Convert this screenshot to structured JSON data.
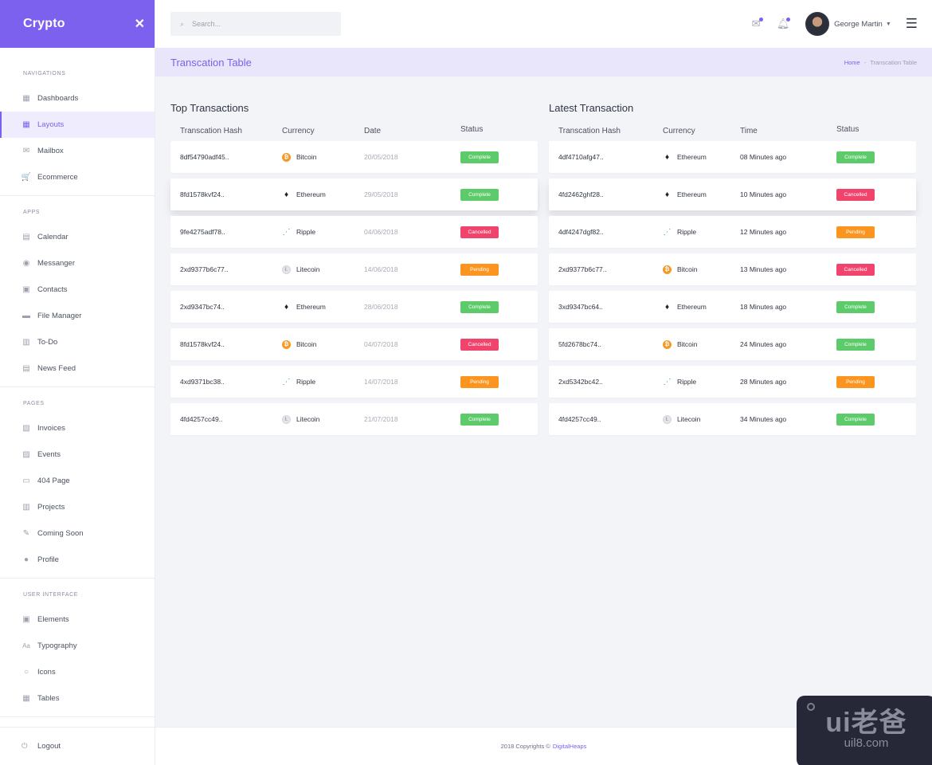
{
  "app": {
    "title": "Crypto"
  },
  "sidebar": {
    "sections": [
      {
        "heading": "Navigations",
        "items": [
          {
            "label": "Dashboards",
            "icon": "dashboard-icon",
            "glyph": "▦"
          },
          {
            "label": "Layouts",
            "icon": "layouts-icon",
            "glyph": "▦",
            "active": true
          },
          {
            "label": "Mailbox",
            "icon": "mail-icon",
            "glyph": "✉"
          },
          {
            "label": "Ecommerce",
            "icon": "cart-icon",
            "glyph": "🛒"
          }
        ]
      },
      {
        "heading": "Apps",
        "items": [
          {
            "label": "Calendar",
            "icon": "calendar-icon",
            "glyph": "▤"
          },
          {
            "label": "Messanger",
            "icon": "chat-icon",
            "glyph": "◉"
          },
          {
            "label": "Contacts",
            "icon": "contacts-icon",
            "glyph": "▣"
          },
          {
            "label": "File Manager",
            "icon": "folder-icon",
            "glyph": "▬"
          },
          {
            "label": "To-Do",
            "icon": "clipboard-icon",
            "glyph": "▥"
          },
          {
            "label": "News Feed",
            "icon": "news-icon",
            "glyph": "▤"
          }
        ]
      },
      {
        "heading": "Pages",
        "items": [
          {
            "label": "Invoices",
            "icon": "invoice-icon",
            "glyph": "▧"
          },
          {
            "label": "Events",
            "icon": "events-icon",
            "glyph": "▨"
          },
          {
            "label": "404 Page",
            "icon": "monitor-icon",
            "glyph": "▭"
          },
          {
            "label": "Projects",
            "icon": "projects-icon",
            "glyph": "▥"
          },
          {
            "label": "Coming Soon",
            "icon": "rocket-icon",
            "glyph": "✎"
          },
          {
            "label": "Profile",
            "icon": "user-icon",
            "glyph": "●"
          }
        ]
      },
      {
        "heading": "User Interface",
        "items": [
          {
            "label": "Elements",
            "icon": "elements-icon",
            "glyph": "▣"
          },
          {
            "label": "Typography",
            "icon": "typography-icon",
            "glyph": "Aa"
          },
          {
            "label": "Icons",
            "icon": "circle-icon",
            "glyph": "○"
          },
          {
            "label": "Tables",
            "icon": "table-icon",
            "glyph": "▦"
          }
        ]
      }
    ],
    "logout_label": "Logout"
  },
  "topbar": {
    "search_placeholder": "Search...",
    "user_name": "George Martin"
  },
  "pagebar": {
    "title": "Transcation Table",
    "breadcrumb": {
      "home": "Home",
      "separator": "-",
      "current": "Transcation Table"
    }
  },
  "top_transactions": {
    "title": "Top Transactions",
    "columns": [
      "Transcation Hash",
      "Currency",
      "Date",
      "Status"
    ],
    "rows": [
      {
        "hash": "8df54790adf45..",
        "currency": "Bitcoin",
        "date": "20/05/2018",
        "status": "Complete"
      },
      {
        "hash": "8fd1578kvf24..",
        "currency": "Ethereum",
        "date": "29/05/2018",
        "status": "Complete"
      },
      {
        "hash": "9fe4275adf78..",
        "currency": "Ripple",
        "date": "04/06/2018",
        "status": "Cancelled"
      },
      {
        "hash": "2xd9377b6c77..",
        "currency": "Litecoin",
        "date": "14/06/2018",
        "status": "Pending"
      },
      {
        "hash": "2xd9347bc74..",
        "currency": "Ethereum",
        "date": "28/06/2018",
        "status": "Complete"
      },
      {
        "hash": "8fd1578kvf24..",
        "currency": "Bitcoin",
        "date": "04/07/2018",
        "status": "Cancelled"
      },
      {
        "hash": "4xd9371bc38..",
        "currency": "Ripple",
        "date": "14/07/2018",
        "status": "Pending"
      },
      {
        "hash": "4fd4257cc49..",
        "currency": "Litecoin",
        "date": "21/07/2018",
        "status": "Complete"
      }
    ]
  },
  "latest_transactions": {
    "title": "Latest Transaction",
    "columns": [
      "Transcation Hash",
      "Currency",
      "Time",
      "Status"
    ],
    "rows": [
      {
        "hash": "4df4710afg47..",
        "currency": "Ethereum",
        "time": "08 Minutes ago",
        "status": "Complete"
      },
      {
        "hash": "4fd2462ghf28..",
        "currency": "Ethereum",
        "time": "10 Minutes ago",
        "status": "Cancelled"
      },
      {
        "hash": "4df4247dgf82..",
        "currency": "Ripple",
        "time": "12 Minutes ago",
        "status": "Pending"
      },
      {
        "hash": "2xd9377b6c77..",
        "currency": "Bitcoin",
        "time": "13 Minutes ago",
        "status": "Cancelled"
      },
      {
        "hash": "3xd9347bc64..",
        "currency": "Ethereum",
        "time": "18 Minutes ago",
        "status": "Complete"
      },
      {
        "hash": "5fd2678bc74..",
        "currency": "Bitcoin",
        "time": "24 Minutes ago",
        "status": "Complete"
      },
      {
        "hash": "2xd5342bc42..",
        "currency": "Ripple",
        "time": "28 Minutes ago",
        "status": "Pending"
      },
      {
        "hash": "4fd4257cc49..",
        "currency": "Litecoin",
        "time": "34 Minutes ago",
        "status": "Complete"
      }
    ]
  },
  "currency_icons": {
    "Bitcoin": {
      "icon": "bitcoin-icon",
      "glyph": "₿",
      "cls": "btc"
    },
    "Ethereum": {
      "icon": "ethereum-icon",
      "glyph": "♦",
      "cls": "eth"
    },
    "Ripple": {
      "icon": "ripple-icon",
      "glyph": "⋰",
      "cls": "xrp"
    },
    "Litecoin": {
      "icon": "litecoin-icon",
      "glyph": "Ł",
      "cls": "ltc"
    }
  },
  "status_colors": {
    "Complete": "#5ecb6b",
    "Cancelled": "#f0446d",
    "Pending": "#fb951f"
  },
  "colors": {
    "accent": "#7b61ee"
  },
  "footer": {
    "text": "2018 Copyrights ©",
    "brand": "DigitalHeaps"
  },
  "watermark": {
    "big": "ui老爸",
    "small": "uil8.com"
  }
}
